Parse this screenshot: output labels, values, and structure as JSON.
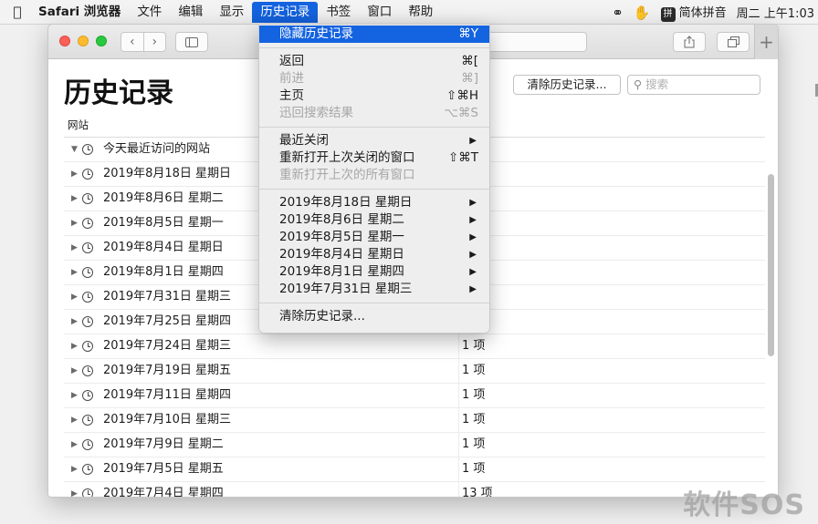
{
  "menubar": {
    "app_name": "Safari 浏览器",
    "items": [
      "文件",
      "编辑",
      "显示",
      "历史记录",
      "书签",
      "窗口",
      "帮助"
    ],
    "input_method": "简体拼音",
    "input_method_badge": "拼",
    "clock": "周二 上午1:03"
  },
  "page": {
    "title": "历史记录",
    "clear_button": "清除历史记录...",
    "search_placeholder": "搜索",
    "column_site": "网站"
  },
  "rows": [
    {
      "name": "今天最近访问的网站",
      "count": "",
      "expanded": true
    },
    {
      "name": "2019年8月18日 星期日",
      "count": ""
    },
    {
      "name": "2019年8月6日 星期二",
      "count": ""
    },
    {
      "name": "2019年8月5日 星期一",
      "count": ""
    },
    {
      "name": "2019年8月4日 星期日",
      "count": ""
    },
    {
      "name": "2019年8月1日 星期四",
      "count": ""
    },
    {
      "name": "2019年7月31日 星期三",
      "count": ""
    },
    {
      "name": "2019年7月25日 星期四",
      "count": ""
    },
    {
      "name": "2019年7月24日 星期三",
      "count": "1 项"
    },
    {
      "name": "2019年7月19日 星期五",
      "count": "1 项"
    },
    {
      "name": "2019年7月11日 星期四",
      "count": "1 项"
    },
    {
      "name": "2019年7月10日 星期三",
      "count": "1 项"
    },
    {
      "name": "2019年7月9日 星期二",
      "count": "1 项"
    },
    {
      "name": "2019年7月5日 星期五",
      "count": "1 项"
    },
    {
      "name": "2019年7月4日 星期四",
      "count": "13 项"
    }
  ],
  "menu": {
    "hide_history": {
      "label": "隐藏历史记录",
      "shortcut": "⌘Y"
    },
    "back": {
      "label": "返回",
      "shortcut": "⌘["
    },
    "forward": {
      "label": "前进",
      "shortcut": "⌘]"
    },
    "home": {
      "label": "主页",
      "shortcut": "⇧⌘H"
    },
    "search_results": {
      "label": "迅回搜索结果",
      "shortcut": "⌥⌘S"
    },
    "recently_closed": {
      "label": "最近关闭"
    },
    "reopen_last": {
      "label": "重新打开上次关闭的窗口",
      "shortcut": "⇧⌘T"
    },
    "reopen_all": {
      "label": "重新打开上次的所有窗口"
    },
    "days": [
      "2019年8月18日 星期日",
      "2019年8月6日 星期二",
      "2019年8月5日 星期一",
      "2019年8月4日 星期日",
      "2019年8月1日 星期四",
      "2019年7月31日 星期三"
    ],
    "clear": {
      "label": "清除历史记录..."
    }
  },
  "watermark": "软件SOS"
}
